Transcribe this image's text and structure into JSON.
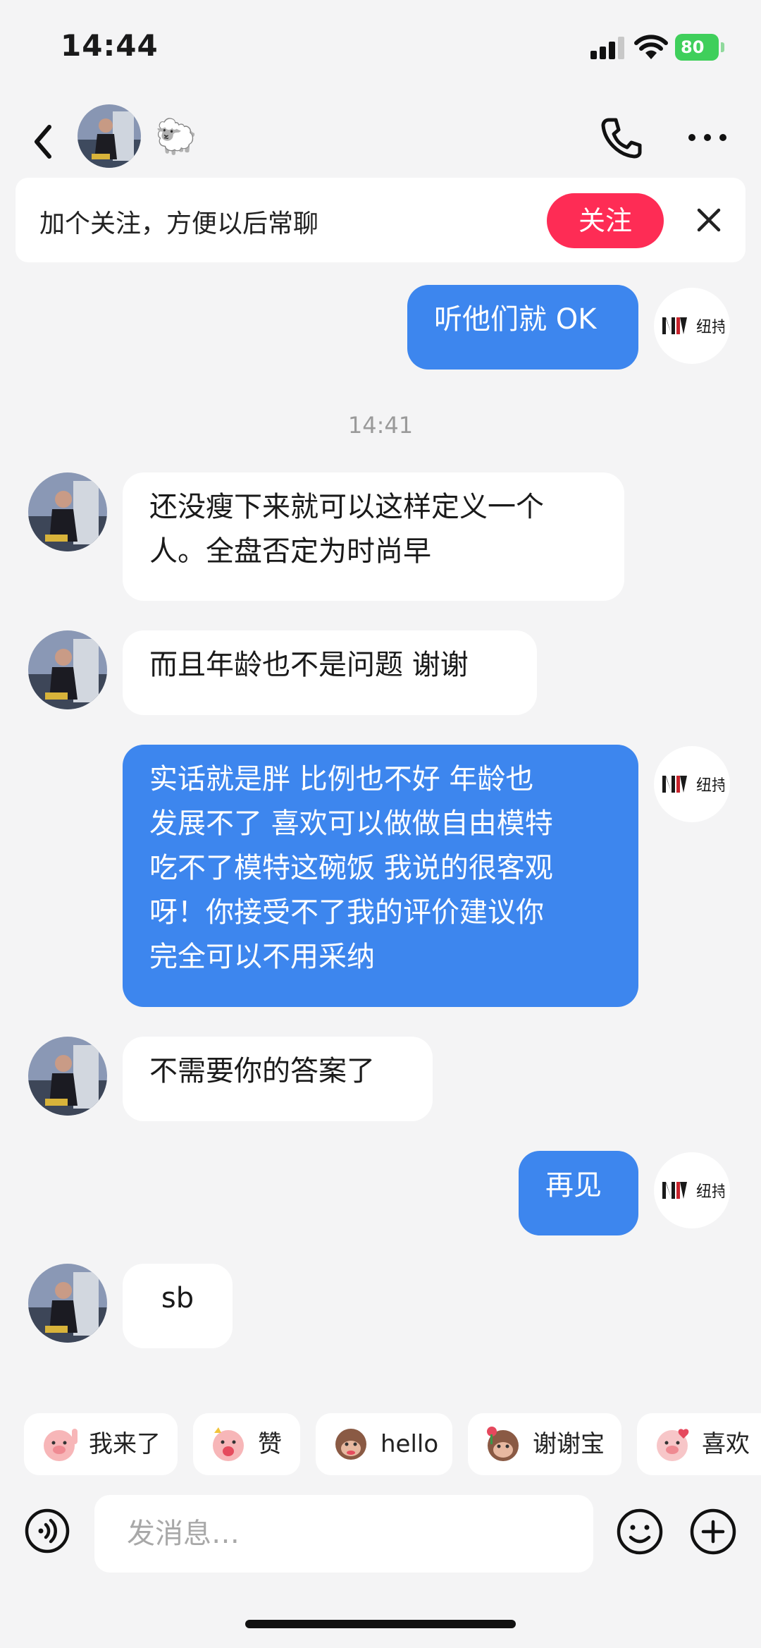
{
  "status_bar": {
    "time": "14:44",
    "battery": "80"
  },
  "header": {
    "contact_name": "🐑"
  },
  "follow_bar": {
    "text": "加个关注，方便以后常聊",
    "button_label": "关注"
  },
  "self_logo_text": "纽持",
  "messages": [
    {
      "sender": "self",
      "text": "听他们就 OK"
    },
    {
      "type": "time",
      "text": "14:41"
    },
    {
      "sender": "contact",
      "text": "还没瘦下来就可以这样定义一个\n人。全盘否定为时尚早"
    },
    {
      "sender": "contact",
      "text": "而且年龄也不是问题 谢谢"
    },
    {
      "sender": "self",
      "text": "实话就是胖 比例也不好 年龄也\n发展不了 喜欢可以做做自由模特\n吃不了模特这碗饭 我说的很客观\n呀！你接受不了我的评价建议你\n完全可以不用采纳"
    },
    {
      "sender": "contact",
      "text": "不需要你的答案了"
    },
    {
      "sender": "self",
      "text": "再见"
    },
    {
      "sender": "contact",
      "text": "sb"
    }
  ],
  "quick_replies": [
    {
      "label": "我来了",
      "icon": "pig-wave-icon"
    },
    {
      "label": "赞",
      "icon": "pig-thumb-icon"
    },
    {
      "label": "hello",
      "icon": "monkey-hello-icon"
    },
    {
      "label": "谢谢宝",
      "icon": "monkey-flower-icon"
    },
    {
      "label": "喜欢",
      "icon": "pig-heart-icon"
    }
  ],
  "input": {
    "placeholder": "发消息…"
  },
  "colors": {
    "accent_blue": "#3d86ee",
    "follow_red": "#fe2c55",
    "background": "#f4f4f5",
    "battery_green": "#3fcf5b"
  }
}
